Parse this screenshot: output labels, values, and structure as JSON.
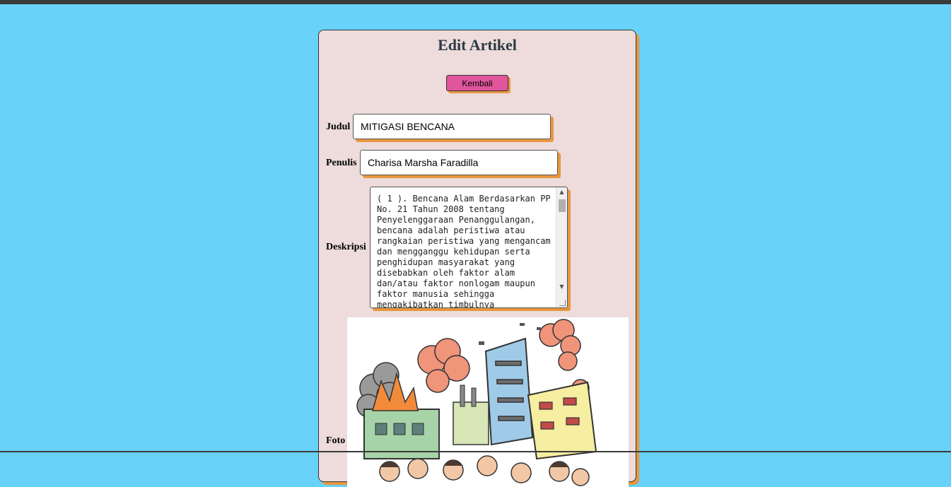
{
  "page": {
    "title": "Edit Artikel",
    "back_label": "Kembali"
  },
  "form": {
    "judul_label": "Judul",
    "judul_value": "MITIGASI BENCANA",
    "penulis_label": "Penulis",
    "penulis_value": "Charisa Marsha Faradilla",
    "deskripsi_label": "Deskripsi",
    "deskripsi_value": "( 1 ). Bencana Alam Berdasarkan PP No. 21 Tahun 2008 tentang Penyelenggaraan Penanggulangan, bencana adalah peristiwa atau rangkaian peristiwa yang mengancam dan mengganggu kehidupan serta penghidupan masyarakat yang disebabkan oleh faktor alam dan/atau faktor nonlogam maupun faktor manusia sehingga mengakibatkan timbulnya",
    "foto_label": "Foto"
  },
  "colors": {
    "background": "#68d2f9",
    "card": "#eddcdb",
    "shadow": "#e9963f",
    "button": "#e0559c"
  },
  "icons": {
    "scroll_up": "scroll-up-arrow-icon",
    "scroll_down": "scroll-down-arrow-icon"
  }
}
